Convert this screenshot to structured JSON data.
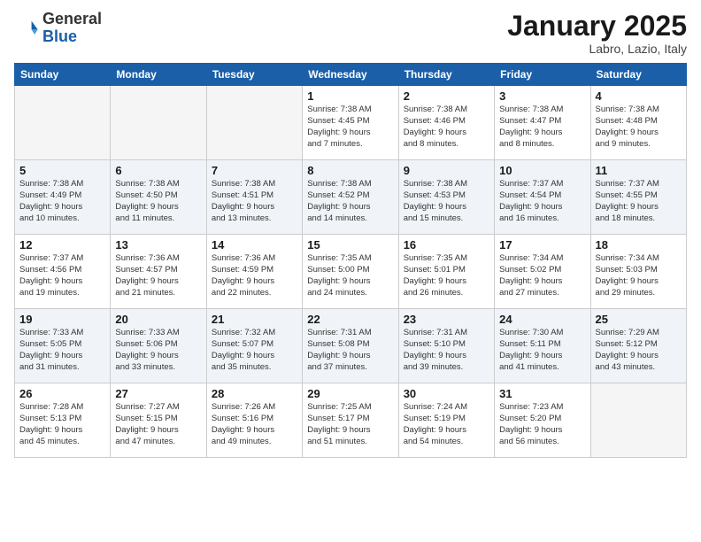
{
  "header": {
    "logo_general": "General",
    "logo_blue": "Blue",
    "month_title": "January 2025",
    "location": "Labro, Lazio, Italy"
  },
  "weekdays": [
    "Sunday",
    "Monday",
    "Tuesday",
    "Wednesday",
    "Thursday",
    "Friday",
    "Saturday"
  ],
  "weeks": [
    [
      {
        "day": "",
        "info": "",
        "empty": true
      },
      {
        "day": "",
        "info": "",
        "empty": true
      },
      {
        "day": "",
        "info": "",
        "empty": true
      },
      {
        "day": "1",
        "info": "Sunrise: 7:38 AM\nSunset: 4:45 PM\nDaylight: 9 hours\nand 7 minutes."
      },
      {
        "day": "2",
        "info": "Sunrise: 7:38 AM\nSunset: 4:46 PM\nDaylight: 9 hours\nand 8 minutes."
      },
      {
        "day": "3",
        "info": "Sunrise: 7:38 AM\nSunset: 4:47 PM\nDaylight: 9 hours\nand 8 minutes."
      },
      {
        "day": "4",
        "info": "Sunrise: 7:38 AM\nSunset: 4:48 PM\nDaylight: 9 hours\nand 9 minutes."
      }
    ],
    [
      {
        "day": "5",
        "info": "Sunrise: 7:38 AM\nSunset: 4:49 PM\nDaylight: 9 hours\nand 10 minutes."
      },
      {
        "day": "6",
        "info": "Sunrise: 7:38 AM\nSunset: 4:50 PM\nDaylight: 9 hours\nand 11 minutes."
      },
      {
        "day": "7",
        "info": "Sunrise: 7:38 AM\nSunset: 4:51 PM\nDaylight: 9 hours\nand 13 minutes."
      },
      {
        "day": "8",
        "info": "Sunrise: 7:38 AM\nSunset: 4:52 PM\nDaylight: 9 hours\nand 14 minutes."
      },
      {
        "day": "9",
        "info": "Sunrise: 7:38 AM\nSunset: 4:53 PM\nDaylight: 9 hours\nand 15 minutes."
      },
      {
        "day": "10",
        "info": "Sunrise: 7:37 AM\nSunset: 4:54 PM\nDaylight: 9 hours\nand 16 minutes."
      },
      {
        "day": "11",
        "info": "Sunrise: 7:37 AM\nSunset: 4:55 PM\nDaylight: 9 hours\nand 18 minutes."
      }
    ],
    [
      {
        "day": "12",
        "info": "Sunrise: 7:37 AM\nSunset: 4:56 PM\nDaylight: 9 hours\nand 19 minutes."
      },
      {
        "day": "13",
        "info": "Sunrise: 7:36 AM\nSunset: 4:57 PM\nDaylight: 9 hours\nand 21 minutes."
      },
      {
        "day": "14",
        "info": "Sunrise: 7:36 AM\nSunset: 4:59 PM\nDaylight: 9 hours\nand 22 minutes."
      },
      {
        "day": "15",
        "info": "Sunrise: 7:35 AM\nSunset: 5:00 PM\nDaylight: 9 hours\nand 24 minutes."
      },
      {
        "day": "16",
        "info": "Sunrise: 7:35 AM\nSunset: 5:01 PM\nDaylight: 9 hours\nand 26 minutes."
      },
      {
        "day": "17",
        "info": "Sunrise: 7:34 AM\nSunset: 5:02 PM\nDaylight: 9 hours\nand 27 minutes."
      },
      {
        "day": "18",
        "info": "Sunrise: 7:34 AM\nSunset: 5:03 PM\nDaylight: 9 hours\nand 29 minutes."
      }
    ],
    [
      {
        "day": "19",
        "info": "Sunrise: 7:33 AM\nSunset: 5:05 PM\nDaylight: 9 hours\nand 31 minutes."
      },
      {
        "day": "20",
        "info": "Sunrise: 7:33 AM\nSunset: 5:06 PM\nDaylight: 9 hours\nand 33 minutes."
      },
      {
        "day": "21",
        "info": "Sunrise: 7:32 AM\nSunset: 5:07 PM\nDaylight: 9 hours\nand 35 minutes."
      },
      {
        "day": "22",
        "info": "Sunrise: 7:31 AM\nSunset: 5:08 PM\nDaylight: 9 hours\nand 37 minutes."
      },
      {
        "day": "23",
        "info": "Sunrise: 7:31 AM\nSunset: 5:10 PM\nDaylight: 9 hours\nand 39 minutes."
      },
      {
        "day": "24",
        "info": "Sunrise: 7:30 AM\nSunset: 5:11 PM\nDaylight: 9 hours\nand 41 minutes."
      },
      {
        "day": "25",
        "info": "Sunrise: 7:29 AM\nSunset: 5:12 PM\nDaylight: 9 hours\nand 43 minutes."
      }
    ],
    [
      {
        "day": "26",
        "info": "Sunrise: 7:28 AM\nSunset: 5:13 PM\nDaylight: 9 hours\nand 45 minutes."
      },
      {
        "day": "27",
        "info": "Sunrise: 7:27 AM\nSunset: 5:15 PM\nDaylight: 9 hours\nand 47 minutes."
      },
      {
        "day": "28",
        "info": "Sunrise: 7:26 AM\nSunset: 5:16 PM\nDaylight: 9 hours\nand 49 minutes."
      },
      {
        "day": "29",
        "info": "Sunrise: 7:25 AM\nSunset: 5:17 PM\nDaylight: 9 hours\nand 51 minutes."
      },
      {
        "day": "30",
        "info": "Sunrise: 7:24 AM\nSunset: 5:19 PM\nDaylight: 9 hours\nand 54 minutes."
      },
      {
        "day": "31",
        "info": "Sunrise: 7:23 AM\nSunset: 5:20 PM\nDaylight: 9 hours\nand 56 minutes."
      },
      {
        "day": "",
        "info": "",
        "empty": true
      }
    ]
  ]
}
